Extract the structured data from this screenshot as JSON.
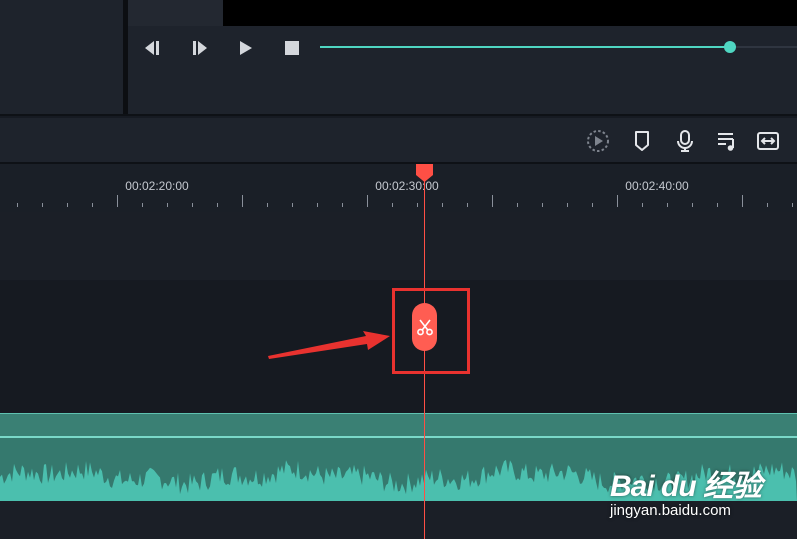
{
  "colors": {
    "accent": "#4fd6c2",
    "playhead": "#ff4f45",
    "annotation": "#e8322f",
    "audio_clip": "#35796e"
  },
  "player": {
    "controls": [
      "step-back-icon",
      "step-forward-icon",
      "play-icon",
      "stop-icon"
    ],
    "progress": 0.86
  },
  "toolbar": {
    "tools": [
      "render-preview-icon",
      "marker-icon",
      "microphone-icon",
      "audio-mixer-icon",
      "fit-timeline-icon"
    ]
  },
  "ruler": {
    "labels": [
      "00:02:20:00",
      "00:02:30:00",
      "00:02:40:00"
    ]
  },
  "timeline": {
    "split_button_icon": "scissors-icon",
    "playhead_time_near": "00:02:30:00"
  },
  "watermark": {
    "logo_text": "Bai du 经验",
    "url": "jingyan.baidu.com"
  }
}
